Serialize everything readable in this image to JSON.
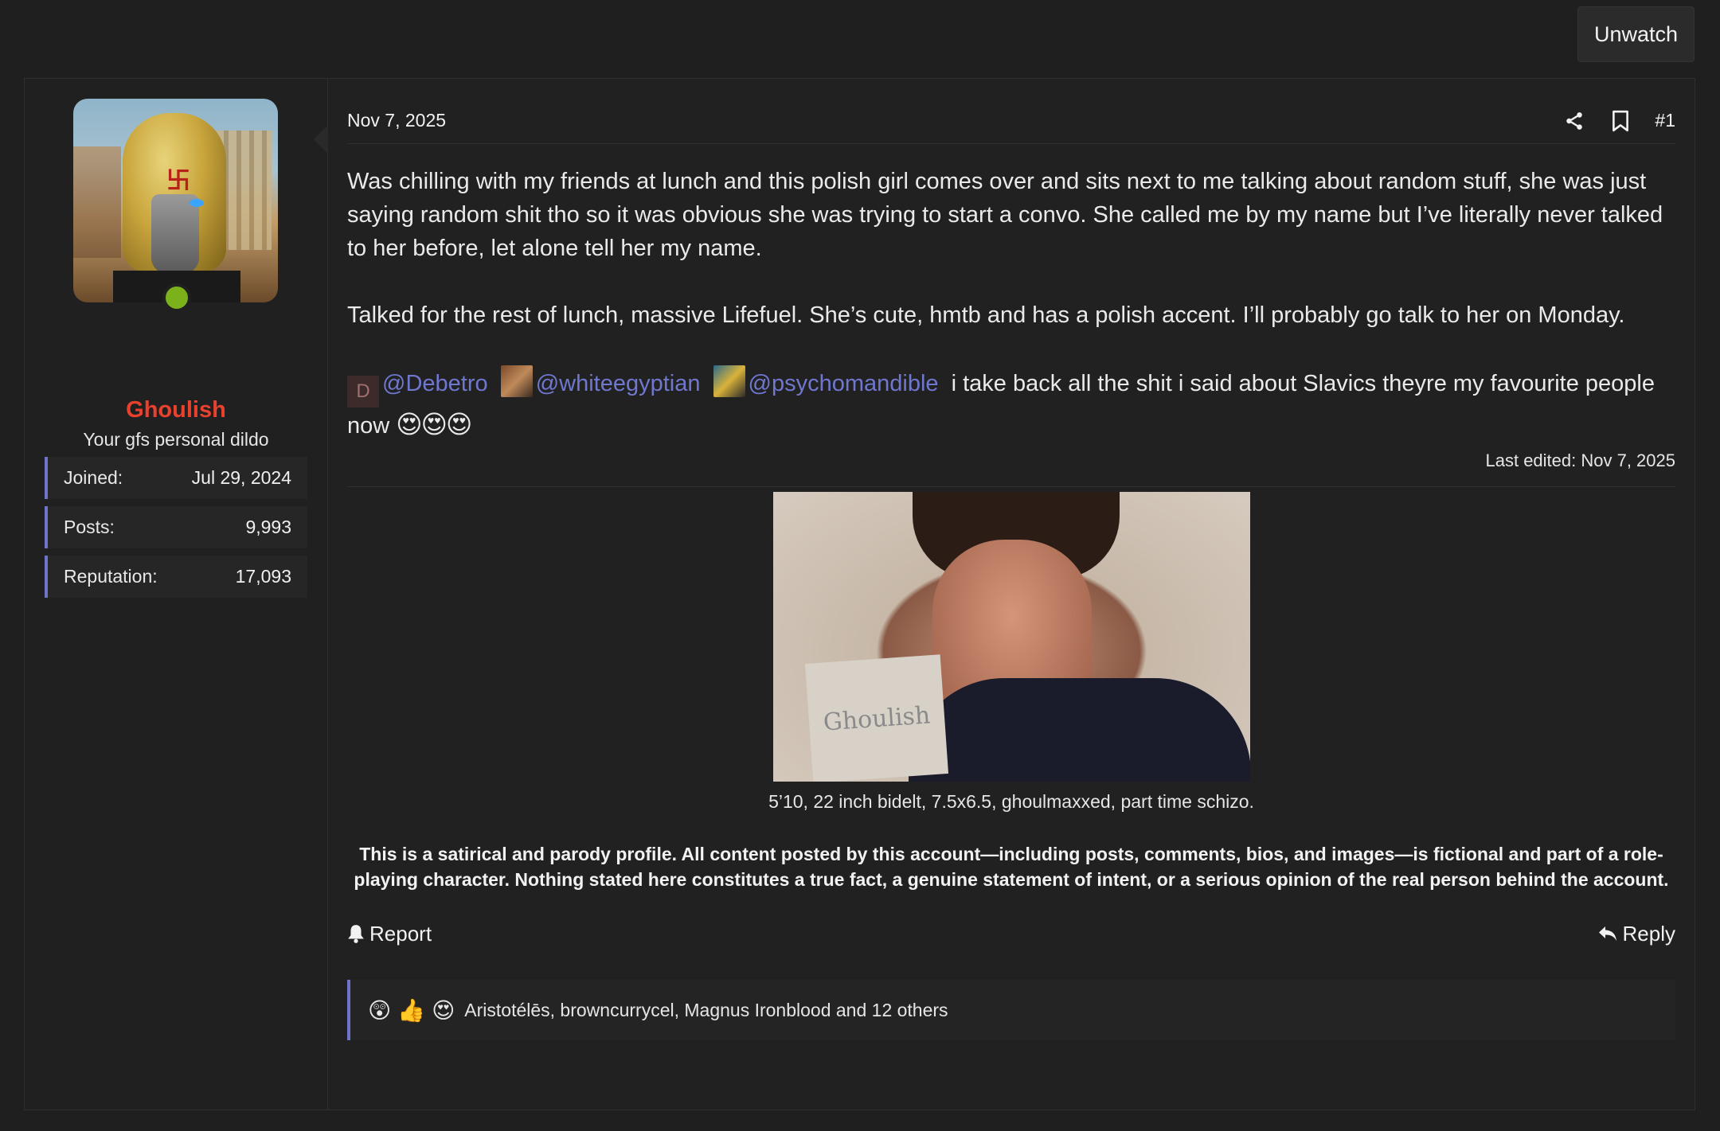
{
  "header": {
    "unwatch_label": "Unwatch"
  },
  "user": {
    "name": "Ghoulish",
    "title": "Your gfs personal dildo",
    "avatar_mark": "卐",
    "stats": [
      {
        "label": "Joined:",
        "value": "Jul 29, 2024"
      },
      {
        "label": "Posts:",
        "value": "9,993"
      },
      {
        "label": "Reputation:",
        "value": "17,093"
      }
    ]
  },
  "post": {
    "date": "Nov 7, 2025",
    "number": "#1",
    "paragraphs": [
      "Was chilling with my friends at lunch and this polish girl comes over and sits next to me talking about random stuff, she was just saying random shit tho so it was obvious she was trying to start a convo. She called me by my name but I’ve literally never talked to her before, let alone tell her my name.",
      "Talked for the rest of lunch, massive Lifefuel. She’s cute, hmtb and has a polish accent. I’ll probably go talk to her on Monday."
    ],
    "mentions": [
      {
        "avatar_letter": "D",
        "name": "@Debetro"
      },
      {
        "name": "@whiteegyptian"
      },
      {
        "name": "@psychomandible"
      }
    ],
    "mention_text": "i take back all the shit i said about Slavics theyre my favourite people now",
    "mention_emojis": "😍😍😍",
    "last_edited": "Last edited: Nov 7, 2025"
  },
  "signature": {
    "photo_note": "Ghoulish",
    "caption": "5’10, 22 inch bidelt, 7.5x6.5, ghoulmaxxed, part time schizo.",
    "disclaimer": "This is a satirical and parody profile. All content posted by this account—including posts, comments, bios, and images—is fictional and part of a role-playing character. Nothing stated here constitutes a true fact, a genuine statement of intent, or a serious opinion of the real person behind the account."
  },
  "actions": {
    "report_label": "Report",
    "reply_label": "Reply"
  },
  "reactions": {
    "emojis": [
      "😲",
      "👍",
      "😍"
    ],
    "names": "Aristotélēs, browncurrycel, Magnus Ironblood and 12 others"
  },
  "colors": {
    "accent": "#6f74c8",
    "username": "#e8412e",
    "online": "#7bb21c",
    "mention": "#6f77cf"
  }
}
